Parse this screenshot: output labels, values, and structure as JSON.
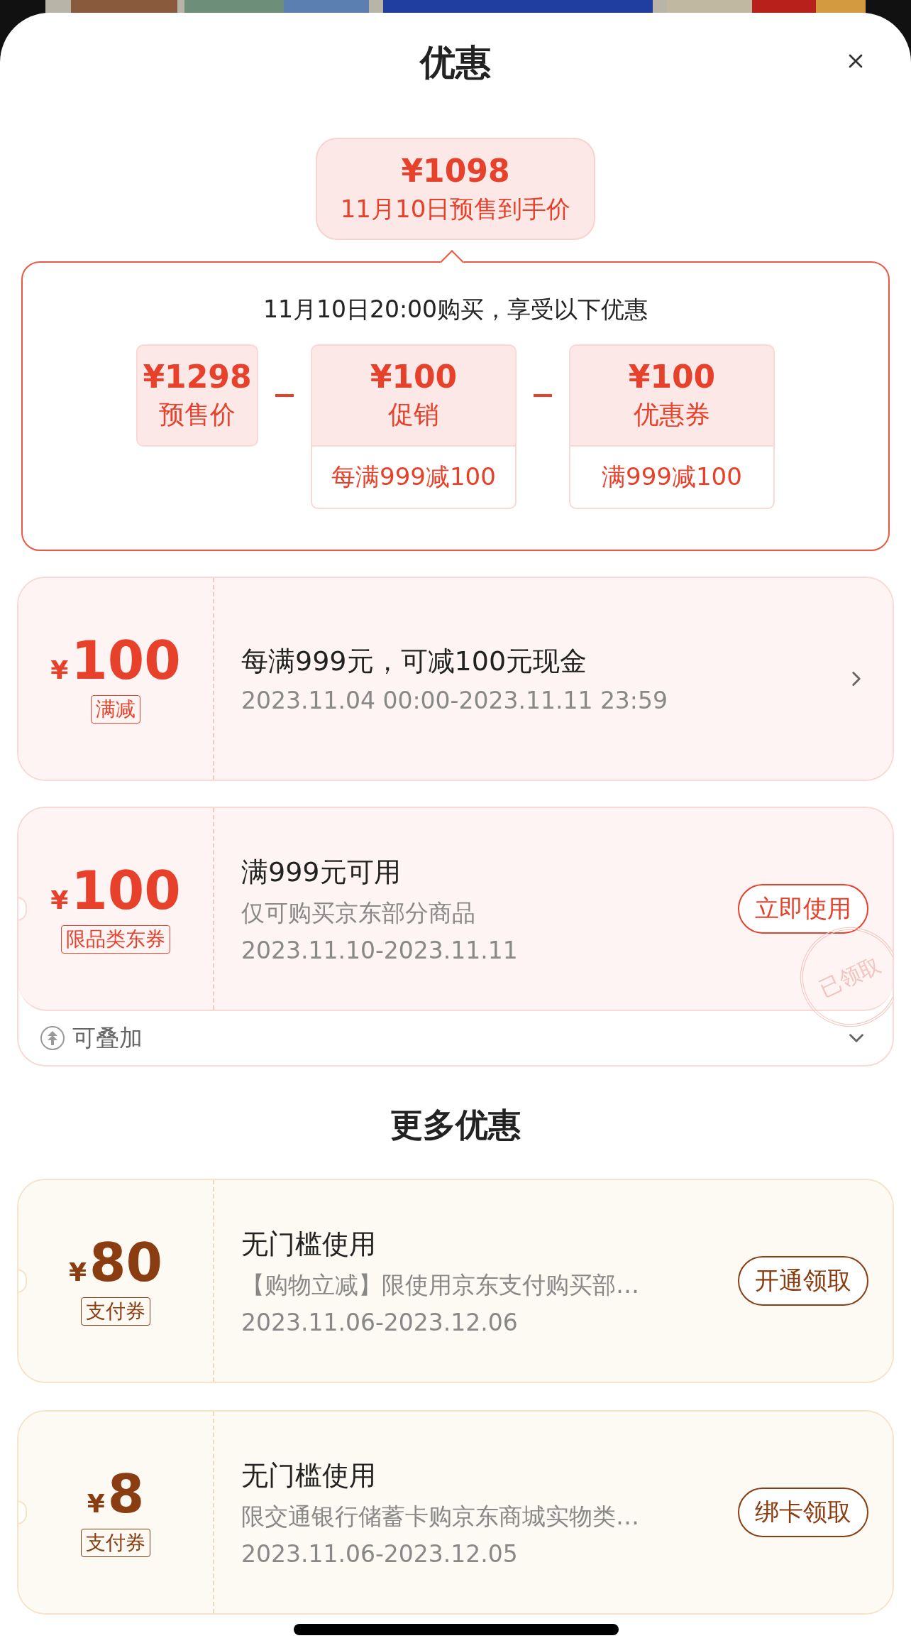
{
  "sheet": {
    "title": "优惠"
  },
  "summary": {
    "price": "¥1098",
    "label": "11月10日预售到手价"
  },
  "breakdown": {
    "heading": "11月10日20:00购买，享受以下优惠",
    "items": [
      {
        "kind": "base",
        "amount": "¥1298",
        "label": "预售价"
      },
      {
        "kind": "discount",
        "amount": "¥100",
        "label": "促销",
        "condition": "每满999减100"
      },
      {
        "kind": "discount",
        "amount": "¥100",
        "label": "优惠券",
        "condition": "满999减100"
      }
    ]
  },
  "coupons": [
    {
      "kind": "discount",
      "currency": "¥",
      "amount": "100",
      "tag": "满减",
      "title": "每满999元，可减100元现金",
      "lines": [
        "2023.11.04 00:00-2023.11.11 23:59"
      ],
      "action": {
        "kind": "chevron"
      }
    },
    {
      "kind": "discount",
      "currency": "¥",
      "amount": "100",
      "tag": "限品类东券",
      "title": "满999元可用",
      "lines": [
        "仅可购买京东部分商品",
        "2023.11.10-2023.11.11"
      ],
      "action": {
        "kind": "button",
        "label": "立即使用"
      },
      "stamp": "已领取",
      "footer": {
        "label": "可叠加",
        "expanded": false
      }
    }
  ],
  "more_title": "更多优惠",
  "more_coupons": [
    {
      "kind": "payment",
      "currency": "¥",
      "amount": "80",
      "tag": "支付券",
      "title": "无门槛使用",
      "lines": [
        "【购物立减】限使用京东支付购买部…",
        "2023.11.06-2023.12.06"
      ],
      "action": {
        "kind": "button",
        "label": "开通领取"
      }
    },
    {
      "kind": "payment",
      "currency": "¥",
      "amount": "8",
      "tag": "支付券",
      "title": "无门槛使用",
      "lines": [
        "限交通银行储蓄卡购京东商城实物类…",
        "2023.11.06-2023.12.05"
      ],
      "action": {
        "kind": "button",
        "label": "绑卡领取"
      }
    }
  ]
}
